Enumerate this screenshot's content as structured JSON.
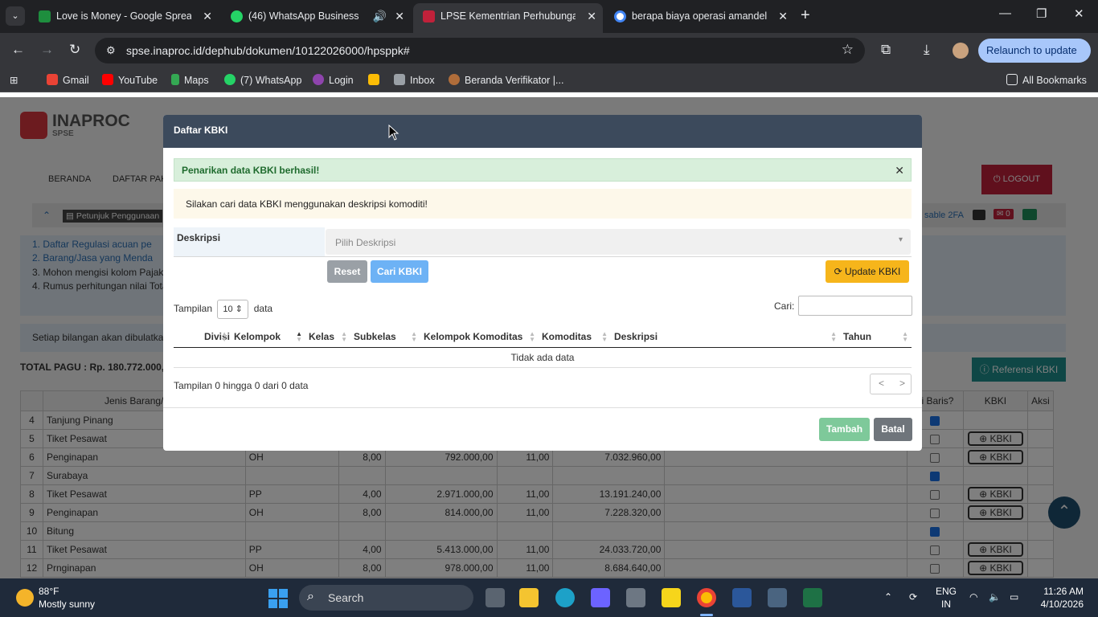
{
  "browser": {
    "tabs": [
      {
        "title": "Love is Money - Google Spread",
        "favicon_color": "#1e8e3e"
      },
      {
        "title": "(46) WhatsApp Business",
        "favicon_color": "#25d366"
      },
      {
        "title": "LPSE Kementrian Perhubungan",
        "favicon_color": "#c0213a"
      },
      {
        "title": "berapa biaya operasi amandel",
        "favicon_color": "#4285f4"
      }
    ],
    "url": "spse.inaproc.id/dephub/dokumen/10122026000/hpsppk#",
    "relaunch_label": "Relaunch to update",
    "bookmarks": [
      "Gmail",
      "YouTube",
      "Maps",
      "(7) WhatsApp",
      "Login",
      "Inbox",
      "Beranda Verifikator |..."
    ],
    "all_bookmarks_label": "All Bookmarks"
  },
  "page": {
    "logo_word": "INAPROC",
    "logo_sub": "SPSE",
    "nav": [
      "BERANDA",
      "DAFTAR PAKET"
    ],
    "logout_label": "LOGOUT",
    "petunjuk_label": "Petunjuk Penggunaan",
    "disable_2fa": "sable 2FA",
    "mail_count": "0",
    "info_lines": [
      "1. Daftar Regulasi acuan pe",
      "2. Barang/Jasa yang Menda",
      "3. Mohon mengisi kolom Pajak",
      "4. Rumus perhitungan nilai Tota"
    ],
    "notice": "Setiap bilangan akan dibulatka",
    "total_pagu": "TOTAL PAGU : Rp. 180.772.000,",
    "referensi_label": "Referensi KBKI",
    "table_headers": {
      "jenis": "Jenis Barang/Jasa",
      "rinci": "ci Baris?",
      "kbki": "KBKI",
      "aksi": "Aksi"
    },
    "rows": [
      {
        "no": "4",
        "name": "Tanjung Pinang",
        "unit": "",
        "vol": "",
        "price": "",
        "tax": "",
        "total": "",
        "checked": true,
        "kbki": false
      },
      {
        "no": "5",
        "name": "Tiket Pesawat",
        "unit": "",
        "vol": "",
        "price": "",
        "tax": "",
        "total": "",
        "checked": false,
        "kbki": true
      },
      {
        "no": "6",
        "name": "Penginapan",
        "unit": "OH",
        "vol": "8,00",
        "price": "792.000,00",
        "tax": "11,00",
        "total": "7.032.960,00",
        "checked": false,
        "kbki": true
      },
      {
        "no": "7",
        "name": "Surabaya",
        "unit": "",
        "vol": "",
        "price": "",
        "tax": "",
        "total": "",
        "checked": true,
        "kbki": false
      },
      {
        "no": "8",
        "name": "Tiket Pesawat",
        "unit": "PP",
        "vol": "4,00",
        "price": "2.971.000,00",
        "tax": "11,00",
        "total": "13.191.240,00",
        "checked": false,
        "kbki": true
      },
      {
        "no": "9",
        "name": "Penginapan",
        "unit": "OH",
        "vol": "8,00",
        "price": "814.000,00",
        "tax": "11,00",
        "total": "7.228.320,00",
        "checked": false,
        "kbki": true
      },
      {
        "no": "10",
        "name": "Bitung",
        "unit": "",
        "vol": "",
        "price": "",
        "tax": "",
        "total": "",
        "checked": true,
        "kbki": false
      },
      {
        "no": "11",
        "name": "Tiket Pesawat",
        "unit": "PP",
        "vol": "4,00",
        "price": "5.413.000,00",
        "tax": "11,00",
        "total": "24.033.720,00",
        "checked": false,
        "kbki": true
      },
      {
        "no": "12",
        "name": "Prnginapan",
        "unit": "OH",
        "vol": "8,00",
        "price": "978.000,00",
        "tax": "11,00",
        "total": "8.684.640,00",
        "checked": false,
        "kbki": true
      }
    ],
    "kbki_btn_label": "KBKI"
  },
  "modal": {
    "title": "Daftar KBKI",
    "success_msg": "Penarikan data KBKI berhasil!",
    "warn_msg": "Silakan cari data KBKI menggunakan deskripsi komoditi!",
    "desc_label": "Deskripsi",
    "desc_placeholder": "Pilih Deskripsi",
    "reset_label": "Reset",
    "cari_label": "Cari KBKI",
    "update_label": "Update KBKI",
    "tampilan_prefix": "Tampilan",
    "tampilan_value": "10",
    "tampilan_suffix": "data",
    "search_label": "Cari:",
    "columns": [
      "Divisi",
      "Kelompok",
      "Kelas",
      "Subkelas",
      "Kelompok Komoditas",
      "Komoditas",
      "Deskripsi",
      "Tahun"
    ],
    "empty_text": "Tidak ada data",
    "info_text": "Tampilan 0 hingga 0 dari 0 data",
    "prev": "<",
    "next": ">",
    "tambah_label": "Tambah",
    "batal_label": "Batal"
  },
  "taskbar": {
    "temp": "88°F",
    "weather": "Mostly sunny",
    "search_placeholder": "Search",
    "lang": "ENG",
    "lang_sub": "IN",
    "time": "11:26 AM",
    "date": "4/10/2026"
  }
}
